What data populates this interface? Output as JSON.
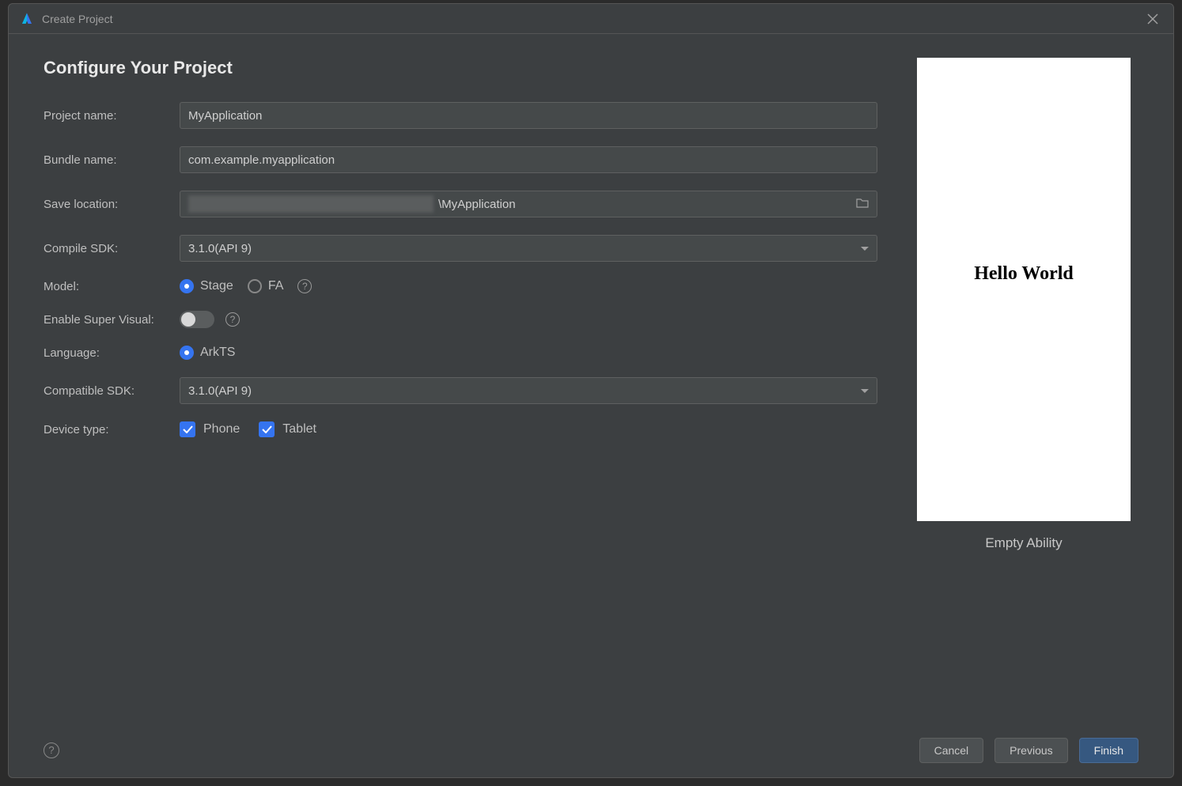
{
  "dialog": {
    "title": "Create Project",
    "heading": "Configure Your Project"
  },
  "fields": {
    "projectName": {
      "label": "Project name:",
      "value": "MyApplication"
    },
    "bundleName": {
      "label": "Bundle name:",
      "value": "com.example.myapplication"
    },
    "saveLocation": {
      "label": "Save location:",
      "suffix": "\\MyApplication"
    },
    "compileSdk": {
      "label": "Compile SDK:",
      "value": "3.1.0(API 9)"
    },
    "model": {
      "label": "Model:",
      "options": [
        "Stage",
        "FA"
      ],
      "selected": "Stage"
    },
    "enableSuperVisual": {
      "label": "Enable Super Visual:",
      "value": false
    },
    "language": {
      "label": "Language:",
      "options": [
        "ArkTS"
      ],
      "selected": "ArkTS"
    },
    "compatibleSdk": {
      "label": "Compatible SDK:",
      "value": "3.1.0(API 9)"
    },
    "deviceType": {
      "label": "Device type:",
      "options": [
        "Phone",
        "Tablet"
      ],
      "checked": [
        "Phone",
        "Tablet"
      ]
    }
  },
  "preview": {
    "text": "Hello World",
    "caption": "Empty Ability"
  },
  "buttons": {
    "cancel": "Cancel",
    "previous": "Previous",
    "finish": "Finish"
  }
}
